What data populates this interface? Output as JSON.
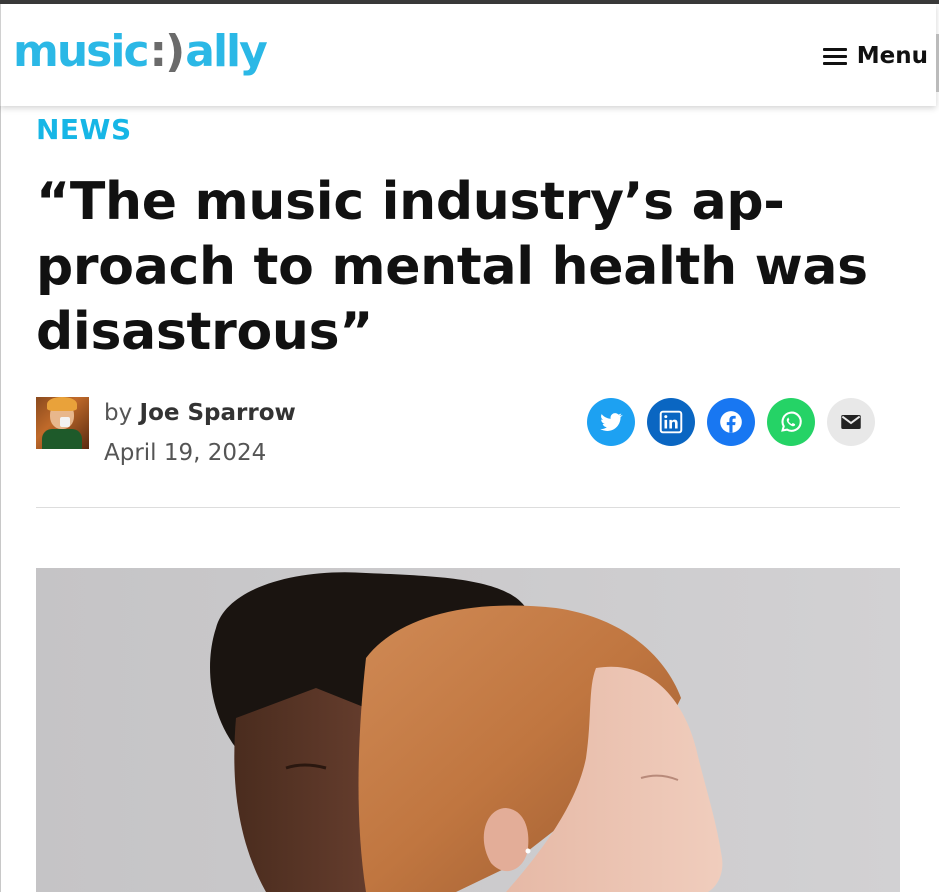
{
  "header": {
    "logo": {
      "part1": "music",
      "part2": ":)",
      "part3": "ally"
    },
    "menu_label": "Menu"
  },
  "article": {
    "category": "NEWS",
    "headline": "“The music industry’s ap-proach to mental health was disastrous”",
    "byline": {
      "prefix": "by",
      "author": "Joe Sparrow"
    },
    "date": "April 19, 2024"
  },
  "share": {
    "buttons": [
      {
        "name": "twitter-icon",
        "color": "#1da1f2"
      },
      {
        "name": "linkedin-icon",
        "color": "#0a66c2"
      },
      {
        "name": "facebook-icon",
        "color": "#1877f2"
      },
      {
        "name": "whatsapp-icon",
        "color": "#25d366"
      },
      {
        "name": "email-icon",
        "color": "#e8e8e8"
      }
    ]
  },
  "colors": {
    "brand": "#2bb8e6",
    "category": "#16b6e6",
    "text": "#111111"
  }
}
